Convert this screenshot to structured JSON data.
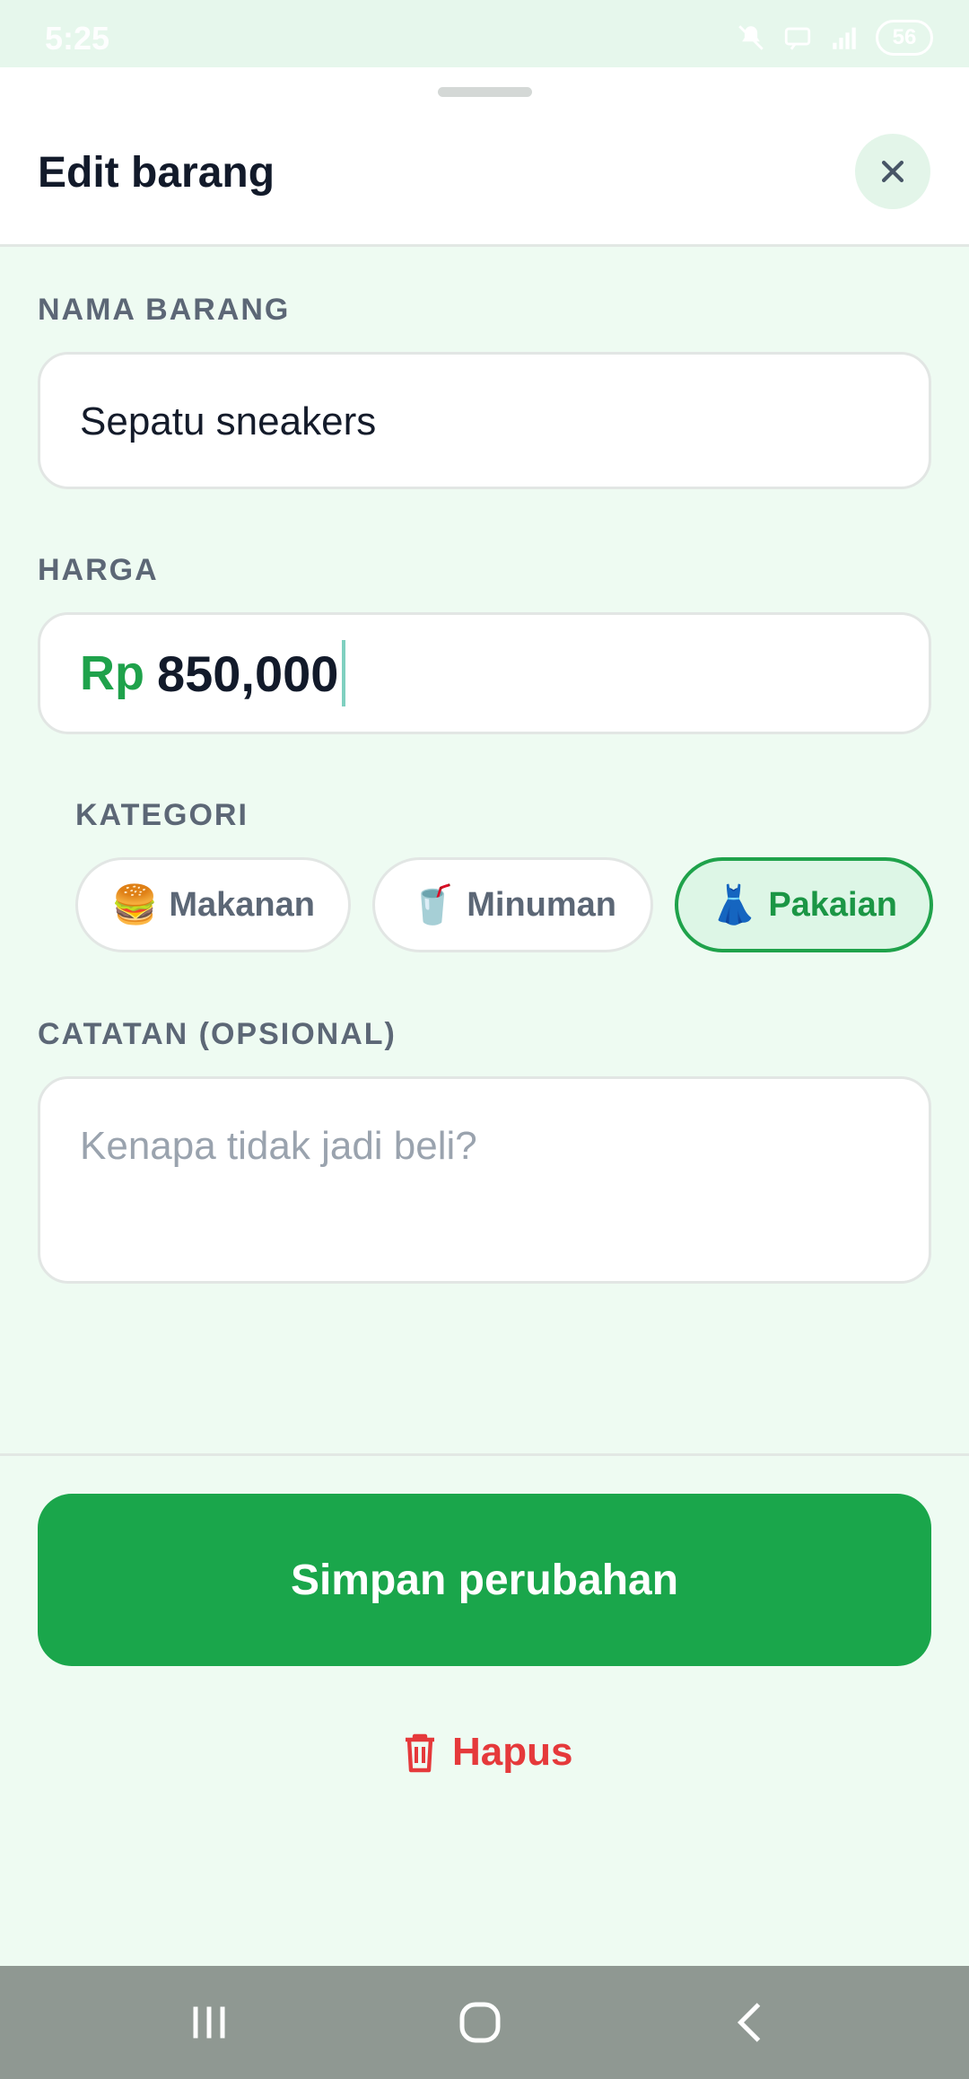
{
  "status_bar": {
    "time": "5:25",
    "battery": "56"
  },
  "sheet": {
    "title": "Edit barang"
  },
  "form": {
    "name": {
      "label": "NAMA BARANG",
      "value": "Sepatu sneakers"
    },
    "price": {
      "label": "HARGA",
      "currency": "Rp",
      "value": "850,000"
    },
    "category": {
      "label": "KATEGORI",
      "options": [
        {
          "emoji": "🍔",
          "label": "Makanan",
          "selected": false
        },
        {
          "emoji": "🥤",
          "label": "Minuman",
          "selected": false
        },
        {
          "emoji": "👗",
          "label": "Pakaian",
          "selected": true
        }
      ]
    },
    "notes": {
      "label": "CATATAN (OPSIONAL)",
      "placeholder": "Kenapa tidak jadi beli?"
    }
  },
  "actions": {
    "save_label": "Simpan perubahan",
    "delete_label": "Hapus"
  },
  "colors": {
    "accent": "#1AA64B",
    "danger": "#E5393B",
    "background": "#EEFBF2"
  }
}
